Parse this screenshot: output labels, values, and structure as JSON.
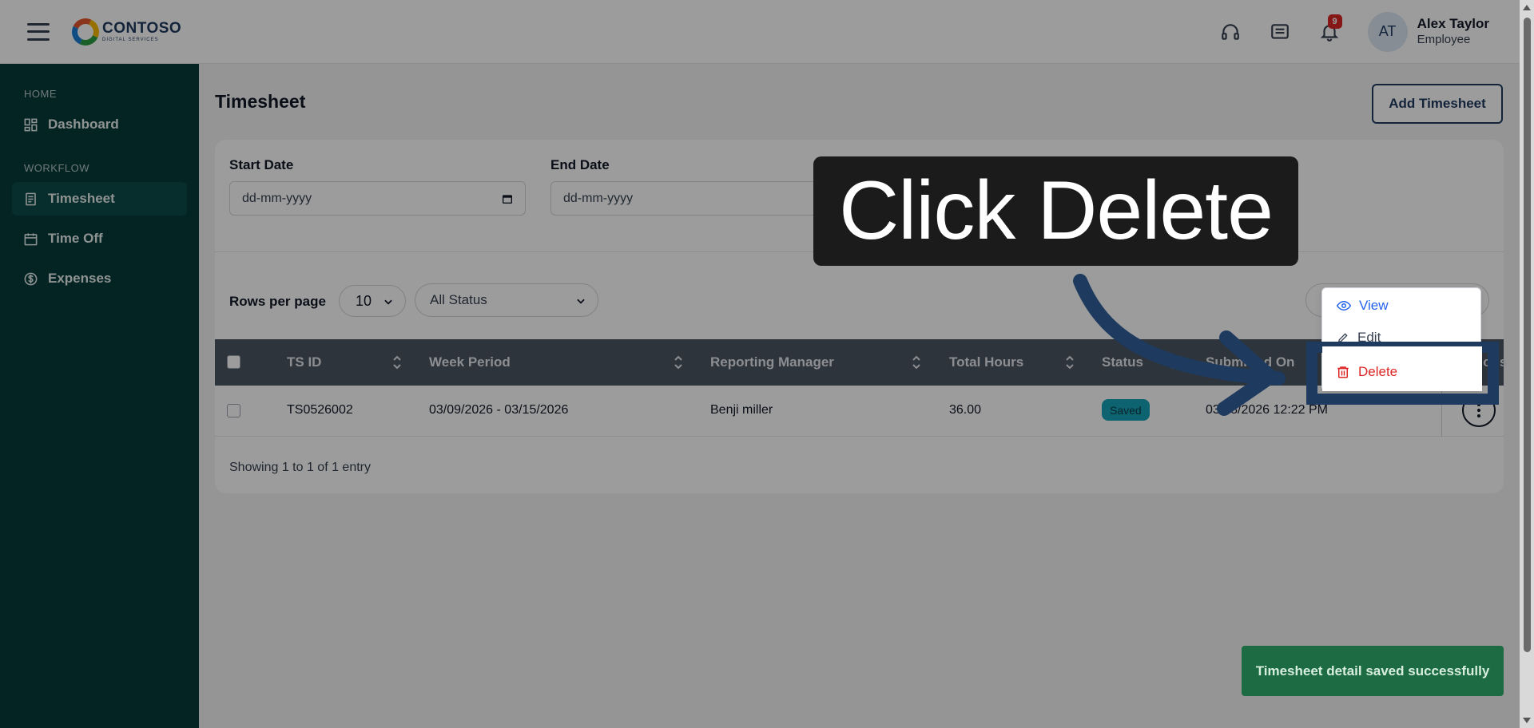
{
  "header": {
    "logo_text": "CONTOSO",
    "logo_subtext": "DIGITAL SERVICES",
    "notification_count": "9",
    "avatar_initials": "AT",
    "user_name": "Alex Taylor",
    "user_role": "Employee",
    "icons": [
      "menu-icon",
      "headset-icon",
      "chat-icon",
      "bell-icon"
    ]
  },
  "sidebar": {
    "sections": [
      {
        "label": "HOME",
        "items": [
          {
            "label": "Dashboard",
            "icon": "dashboard-icon"
          }
        ]
      },
      {
        "label": "WORKFLOW",
        "items": [
          {
            "label": "Timesheet",
            "icon": "timesheet-icon",
            "active": true
          },
          {
            "label": "Time Off",
            "icon": "calendar-icon"
          },
          {
            "label": "Expenses",
            "icon": "dollar-icon"
          }
        ]
      }
    ]
  },
  "page": {
    "title": "Timesheet",
    "add_button": "Add Timesheet"
  },
  "filters": {
    "start_label": "Start Date",
    "start_placeholder": "dd-mm-yyyy",
    "end_label": "End Date",
    "end_placeholder": "dd-mm-yyyy"
  },
  "table_controls": {
    "rows_label": "Rows per page",
    "rows_value": "10",
    "status_value": "All Status"
  },
  "table": {
    "columns": [
      "TS ID",
      "Week Period",
      "Reporting Manager",
      "Total Hours",
      "Status",
      "Submitted On",
      "Actions"
    ],
    "rows": [
      {
        "ts_id": "TS0526002",
        "week": "03/09/2026 - 03/15/2026",
        "manager": "Benji miller",
        "hours": "36.00",
        "status": "Saved",
        "submitted": "03/18/2026 12:22 PM"
      }
    ],
    "summary": "Showing 1 to 1 of 1 entry"
  },
  "action_menu": {
    "view": "View",
    "edit": "Edit",
    "delete": "Delete"
  },
  "callout": {
    "text": "Click Delete"
  },
  "toast": {
    "message": "Timesheet detail saved successfully"
  },
  "colors": {
    "sidebar_bg": "#053b3a",
    "brand_navy": "#1e3a5f",
    "status_saved": "#17a2b8",
    "toast_bg": "#1d6b43",
    "danger": "#dc2626"
  }
}
